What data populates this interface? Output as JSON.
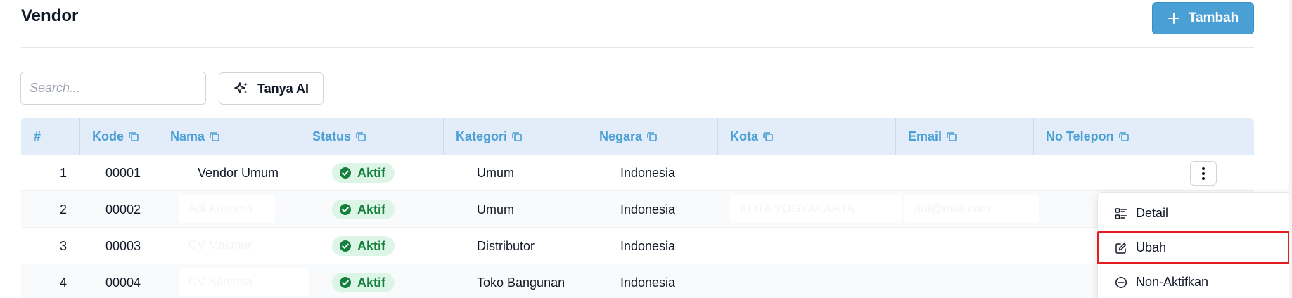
{
  "page": {
    "title": "Vendor"
  },
  "actions": {
    "add_label": "Tambah",
    "ai_label": "Tanya AI"
  },
  "search": {
    "placeholder": "Search...",
    "value": ""
  },
  "colors": {
    "accent": "#4a9fd4",
    "status_green": "#15803d",
    "status_bg": "#dcf5e6",
    "highlight_red": "#e11d1d"
  },
  "table": {
    "headers": [
      "#",
      "Kode",
      "Nama",
      "Status",
      "Kategori",
      "Negara",
      "Kota",
      "Email",
      "No Telepon"
    ],
    "rows": [
      {
        "no": "1",
        "kode": "00001",
        "nama": "Vendor Umum",
        "status": "Aktif",
        "kategori": "Umum",
        "negara": "Indonesia",
        "kota": "",
        "email": "",
        "telepon": ""
      },
      {
        "no": "2",
        "kode": "00002",
        "nama": "Adi Kusuma",
        "status": "Aktif",
        "kategori": "Umum",
        "negara": "Indonesia",
        "kota": "KOTA YOGYAKARTA",
        "email": "adi@mail.com",
        "telepon": ""
      },
      {
        "no": "3",
        "kode": "00003",
        "nama": "CV Makmur",
        "status": "Aktif",
        "kategori": "Distributor",
        "negara": "Indonesia",
        "kota": "",
        "email": "",
        "telepon": ""
      },
      {
        "no": "4",
        "kode": "00004",
        "nama": "CV Sentosa",
        "status": "Aktif",
        "kategori": "Toko Bangunan",
        "negara": "Indonesia",
        "kota": "",
        "email": "",
        "telepon": ""
      }
    ]
  },
  "row_menu": {
    "items": [
      {
        "label": "Detail",
        "icon": "list-detail-icon"
      },
      {
        "label": "Ubah",
        "icon": "edit-icon"
      },
      {
        "label": "Non-Aktifkan",
        "icon": "minus-circle-icon"
      }
    ]
  }
}
